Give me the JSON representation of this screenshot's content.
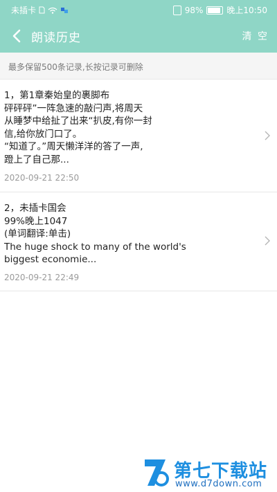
{
  "status_bar": {
    "carrier": "未插卡",
    "battery_percent": "98%",
    "time": "晚上10:50",
    "battery_level": 0.98
  },
  "header": {
    "title": "朗读历史",
    "clear_label": "清 空"
  },
  "hint": "最多保留500条记录,长按记录可删除",
  "records": [
    {
      "content": "1，第1章秦始皇的裹脚布\n砰砰砰”一阵急速的敲闩声,将周天\n从睡梦中给扯了出来“扒皮,有你一封\n信,给你放门口了。\n“知道了。”周天懒洋洋的答了一声,\n蹬上了自己那...",
      "date": "2020-09-21 22:50"
    },
    {
      "content": "2，未插卡国会\n99%晚上1047\n(单词翻译:单击)\nThe huge shock to many of the world's\nbiggest economie...",
      "date": "2020-09-21 22:49"
    }
  ],
  "watermark": {
    "name": "第七下载站",
    "url": "www.d7down.com"
  },
  "colors": {
    "header_bg": "#8fd6c6",
    "watermark": "#1e8fe0"
  }
}
